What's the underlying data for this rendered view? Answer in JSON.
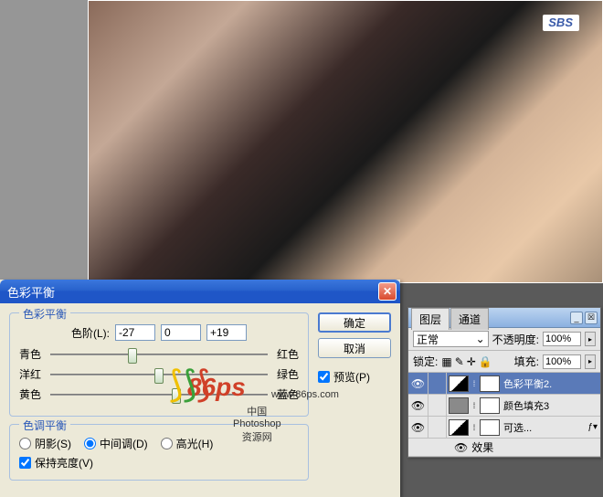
{
  "canvas": {
    "network_logo": "SBS"
  },
  "dialog": {
    "title": "色彩平衡",
    "section_balance": "色彩平衡",
    "levels_label": "色阶(L):",
    "levels": [
      "-27",
      "0",
      "+19"
    ],
    "sliders": [
      {
        "left": "青色",
        "right": "红色",
        "pos": 38
      },
      {
        "left": "洋红",
        "right": "绿色",
        "pos": 50
      },
      {
        "left": "黄色",
        "right": "蓝色",
        "pos": 58
      }
    ],
    "section_tone": "色调平衡",
    "tone": {
      "shadows": "阴影(S)",
      "midtones": "中间调(D)",
      "highlights": "高光(H)",
      "selected": "midtones"
    },
    "preserve_lum": "保持亮度(V)",
    "preserve_checked": true,
    "buttons": {
      "ok": "确定",
      "cancel": "取消",
      "preview": "预览(P)"
    },
    "preview_checked": true
  },
  "layers": {
    "tabs": [
      "图层",
      "通道"
    ],
    "blend_mode": "正常",
    "opacity_label": "不透明度:",
    "opacity": "100%",
    "lock_label": "锁定:",
    "fill_label": "填充:",
    "fill": "100%",
    "items": [
      {
        "name": "色彩平衡2.",
        "type": "adj",
        "selected": true,
        "fx": false
      },
      {
        "name": "颜色填充3",
        "type": "fill",
        "selected": false,
        "fx": false
      },
      {
        "name": "可选...",
        "type": "adj",
        "selected": false,
        "fx": true
      }
    ],
    "effects_label": "效果"
  },
  "watermark": {
    "brand": "86ps",
    "url": "www.86ps.com",
    "cn": "中国Photoshop资源网"
  }
}
